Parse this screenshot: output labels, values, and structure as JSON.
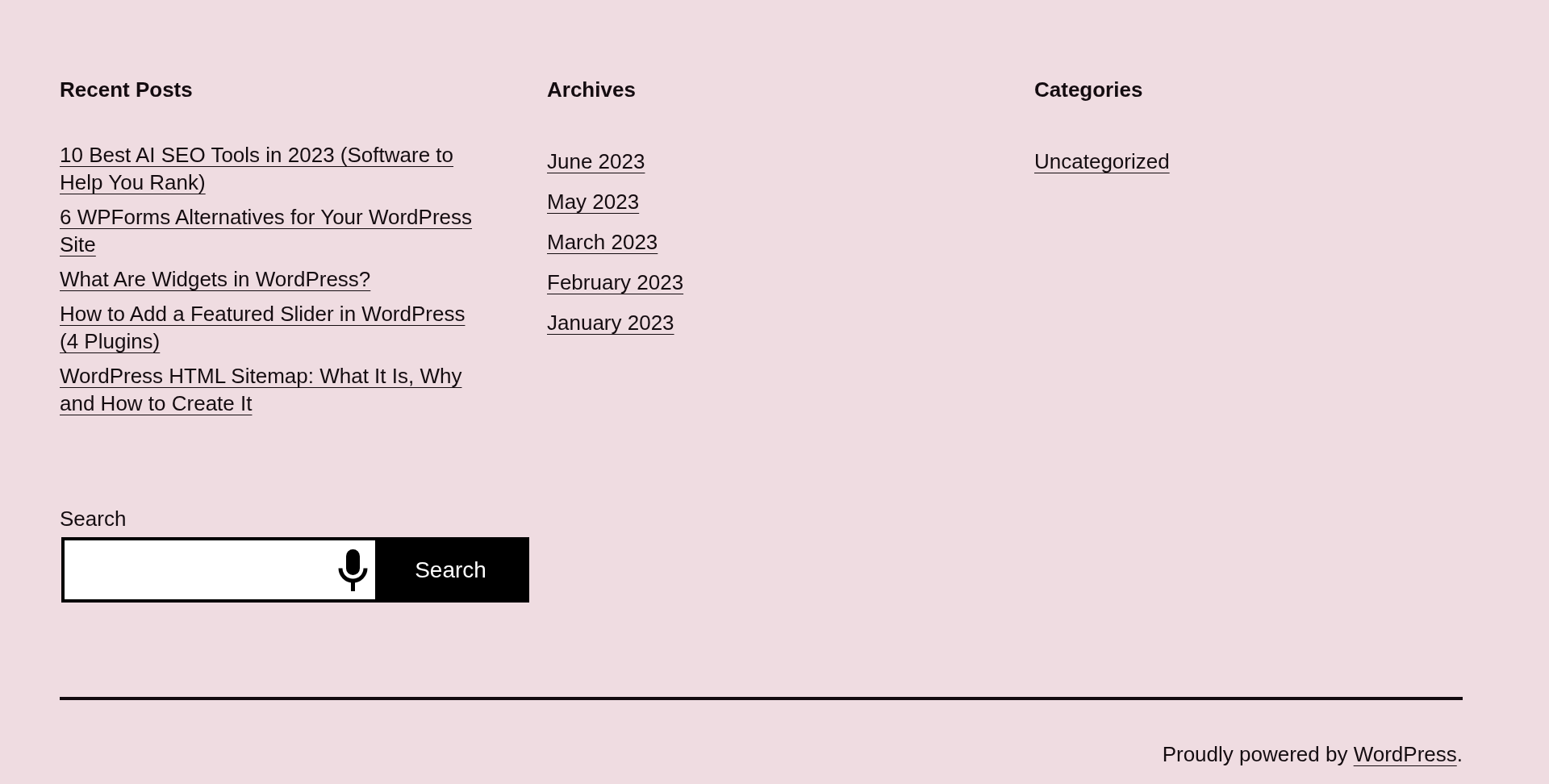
{
  "widgets": [
    {
      "kind": "posts",
      "title": "Recent Posts",
      "links": [
        "10 Best AI SEO Tools in 2023 (Software to Help You Rank)",
        "6 WPForms Alternatives for Your WordPress Site",
        "What Are Widgets in WordPress?",
        "How to Add a Featured Slider in WordPress (4 Plugins)",
        "WordPress HTML Sitemap: What It Is, Why and How to Create It"
      ]
    },
    {
      "kind": "archives",
      "title": "Archives",
      "links": [
        "June 2023",
        "May 2023",
        "March 2023",
        "February 2023",
        "January 2023"
      ]
    },
    {
      "kind": "categories",
      "title": "Categories",
      "links": [
        "Uncategorized"
      ]
    }
  ],
  "search": {
    "label": "Search",
    "button": "Search"
  },
  "footer": {
    "text": "Proudly powered by",
    "link": "WordPress",
    "end": "."
  }
}
